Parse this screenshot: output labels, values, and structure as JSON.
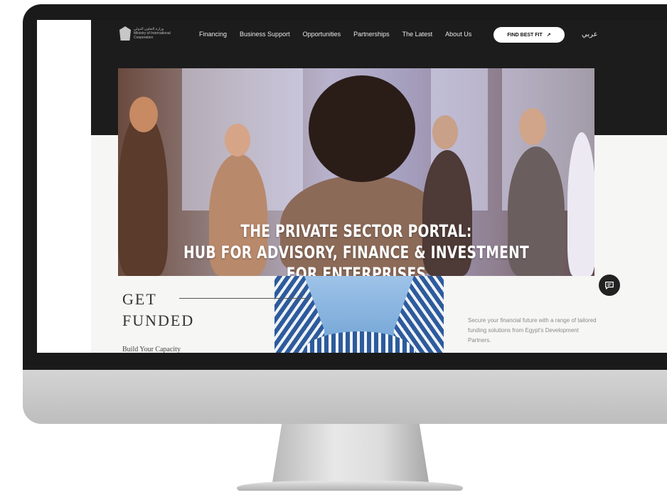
{
  "header": {
    "logo_lines": [
      "وزارة التعاون الدولي",
      "Ministry of International",
      "Cooperation"
    ],
    "nav_items": [
      "Financing",
      "Business Support",
      "Opportunities",
      "Partnerships",
      "The Latest",
      "About Us"
    ],
    "cta_label": "FIND BEST FIT",
    "cta_icon": "arrow-up-right-icon",
    "language_label": "عربي"
  },
  "hero": {
    "title_line1": "THE PRIVATE SECTOR PORTAL:",
    "title_line2": "HUB FOR ADVISORY, FINANCE & INVESTMENT FOR ENTERPRISES"
  },
  "section": {
    "heading_line1": "GET",
    "heading_line2": "FUNDED",
    "subheading": "Build Your Capacity",
    "description": "Secure your financial future with a range of tailored funding solutions from Egypt's Development Partners."
  },
  "chat": {
    "icon": "chat-bubble-icon"
  },
  "colors": {
    "nav_bg": "#1c1c1c",
    "cta_bg": "#ffffff",
    "hero_text": "#ffffff",
    "page_bg": "#f6f6f4"
  }
}
